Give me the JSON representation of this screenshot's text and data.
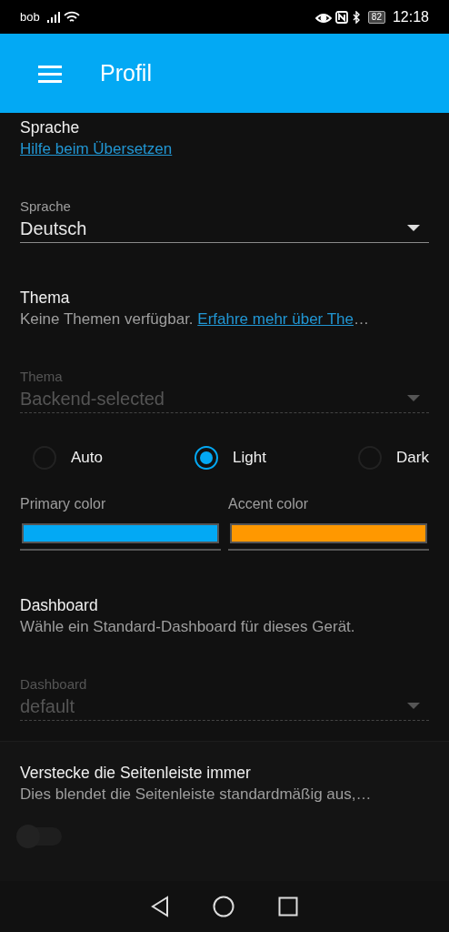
{
  "status_bar": {
    "carrier": "bob",
    "battery": "82",
    "time": "12:18"
  },
  "app_bar": {
    "title": "Profil"
  },
  "cards": [
    {
      "items": [
        {
          "kind": "header",
          "title": "Sprache",
          "link": "Hilfe beim Übersetzen"
        },
        {
          "kind": "select",
          "label": "Sprache",
          "value": "Deutsch",
          "disabled": false
        },
        {
          "kind": "header",
          "title": "Thema",
          "text": "Keine Themen verfügbar.",
          "link": "Erfahre mehr über The",
          "trailing": "…"
        },
        {
          "kind": "select",
          "label": "Thema",
          "value": "Backend-selected",
          "disabled": true
        },
        {
          "kind": "radios",
          "options": [
            {
              "label": "Auto",
              "selected": false
            },
            {
              "label": "Light",
              "selected": true
            },
            {
              "label": "Dark",
              "selected": false
            }
          ]
        },
        {
          "kind": "colors",
          "pickers": [
            {
              "label": "Primary color",
              "color": "#03a9f4"
            },
            {
              "label": "Accent color",
              "color": "#ff9800"
            }
          ]
        },
        {
          "kind": "header",
          "title": "Dashboard",
          "text": "Wähle ein Standard-Dashboard für dieses Gerät."
        },
        {
          "kind": "select",
          "label": "Dashboard",
          "value": "default",
          "disabled": true
        }
      ]
    },
    {
      "items": [
        {
          "kind": "header",
          "title": "Verstecke die Seitenleiste immer",
          "text": "Dies blendet die Seitenleiste standardmäßig aus,…"
        },
        {
          "kind": "toggle",
          "on": false
        }
      ]
    }
  ]
}
